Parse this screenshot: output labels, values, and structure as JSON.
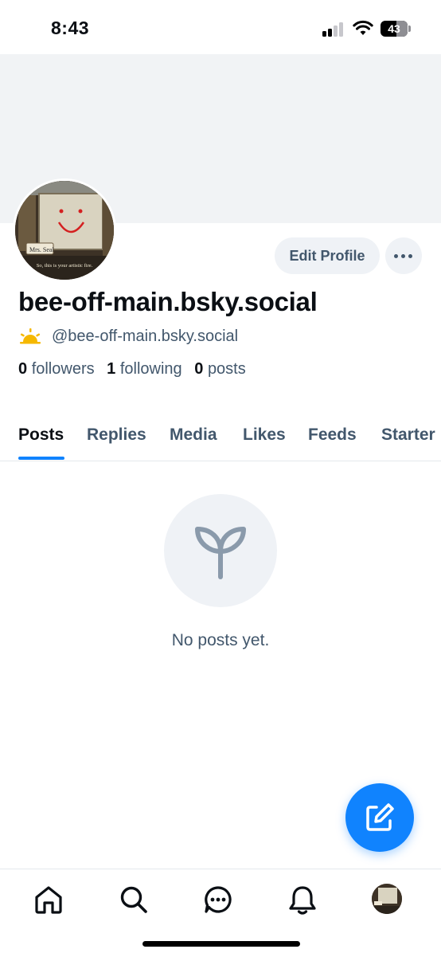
{
  "status_bar": {
    "time": "8:43",
    "battery_level": "43",
    "icons": [
      "cellular-signal-icon",
      "wifi-icon",
      "battery-icon"
    ]
  },
  "profile": {
    "display_name": "bee-off-main.bsky.social",
    "handle": "@bee-off-main.bsky.social",
    "avatar_caption_top": "Mrs. Seal",
    "avatar_caption_bottom": "So, this is your artistic fire.",
    "stats": [
      {
        "count": "0",
        "label": "followers"
      },
      {
        "count": "1",
        "label": "following"
      },
      {
        "count": "0",
        "label": "posts"
      }
    ]
  },
  "actions": {
    "edit_profile_label": "Edit Profile",
    "more_icon": "ellipsis-icon"
  },
  "tabs": [
    {
      "label": "Posts",
      "active": true
    },
    {
      "label": "Replies",
      "active": false
    },
    {
      "label": "Media",
      "active": false
    },
    {
      "label": "Likes",
      "active": false
    },
    {
      "label": "Feeds",
      "active": false
    },
    {
      "label": "Starter",
      "active": false
    }
  ],
  "empty_state": {
    "icon": "seedling-icon",
    "message": "No posts yet."
  },
  "fab": {
    "icon": "compose-icon"
  },
  "bottom_nav": {
    "items": [
      "home-icon",
      "search-icon",
      "chat-icon",
      "notifications-icon",
      "profile-avatar"
    ]
  },
  "colors": {
    "accent": "#1083fe",
    "muted_text": "#42576c",
    "banner": "#f1f3f5",
    "button_bg": "#eff2f6"
  }
}
